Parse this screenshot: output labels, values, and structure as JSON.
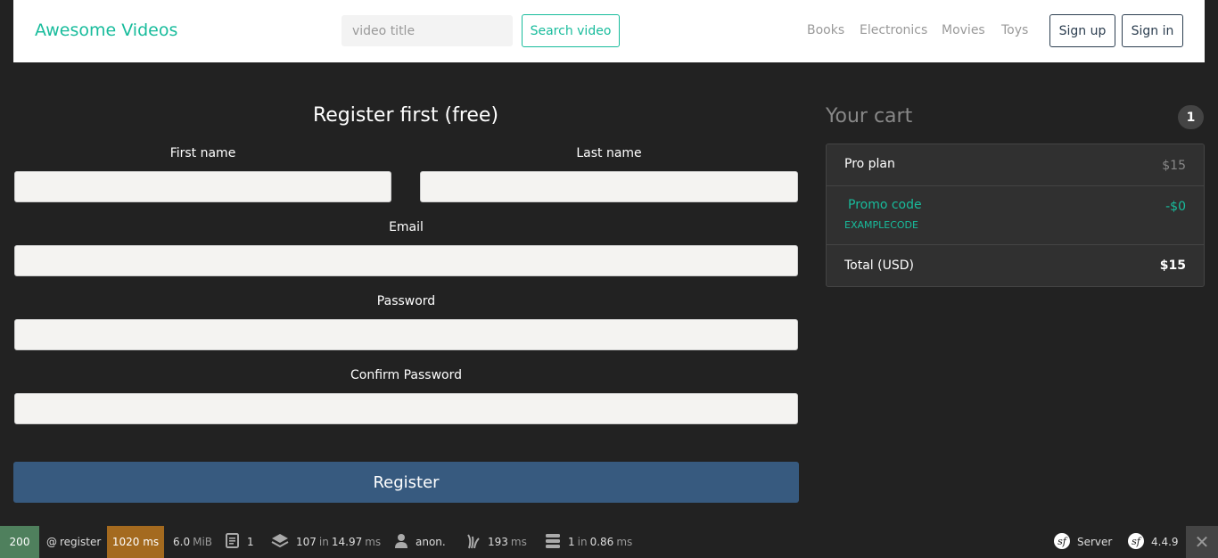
{
  "navbar": {
    "brand": "Awesome Videos",
    "search_placeholder": "video title",
    "search_button": "Search video",
    "links": [
      "Books",
      "Electronics",
      "Movies",
      "Toys"
    ],
    "signup": "Sign up",
    "signin": "Sign in"
  },
  "form": {
    "title": "Register first (free)",
    "first_name_label": "First name",
    "last_name_label": "Last name",
    "email_label": "Email",
    "password_label": "Password",
    "confirm_password_label": "Confirm Password",
    "submit": "Register"
  },
  "cart": {
    "title": "Your cart",
    "count": "1",
    "items": [
      {
        "name": "Pro plan",
        "price": "$15"
      }
    ],
    "promo": {
      "name": "Promo code",
      "code": "EXAMPLECODE",
      "price": "-$0"
    },
    "total_label": "Total (USD)",
    "total_value": "$15"
  },
  "toolbar": {
    "status": "200",
    "route_prefix": "@",
    "route": "register",
    "time": "1020 ms",
    "memory": "6.0",
    "memory_unit": "MiB",
    "logs": "1",
    "cache_calls": "107",
    "in_word": "in",
    "cache_time": "14.97",
    "ms": "ms",
    "user": "anon.",
    "twig_time": "193",
    "db_queries": "1",
    "db_time": "0.86",
    "server": "Server",
    "version": "4.4.9",
    "colors": {
      "status_bg": "#4f805d",
      "time_bg": "#a46a1f",
      "accent": "#18bc9c",
      "primary": "#375a7f"
    }
  }
}
